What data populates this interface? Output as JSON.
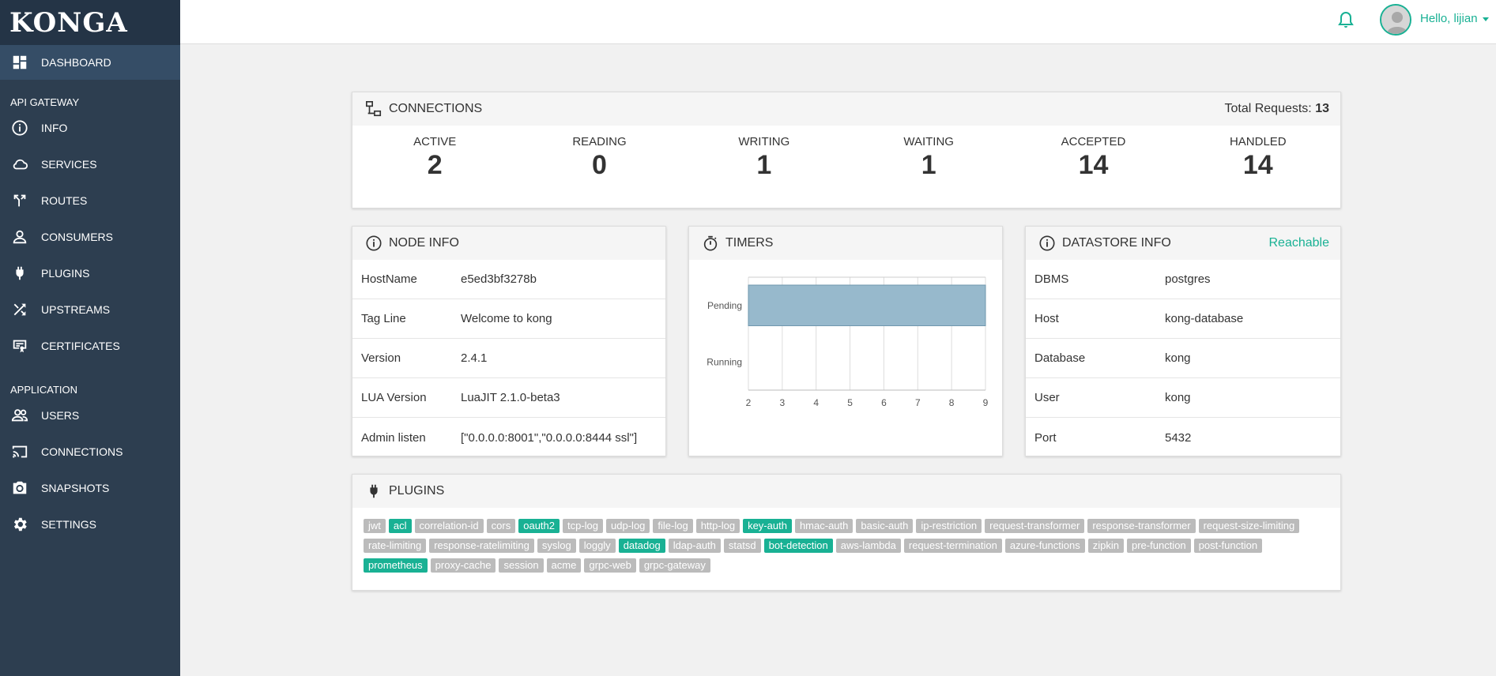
{
  "brand": "KONGA",
  "nav": {
    "dashboard": "DASHBOARD",
    "section_api": "API GATEWAY",
    "api_items": [
      "INFO",
      "SERVICES",
      "ROUTES",
      "CONSUMERS",
      "PLUGINS",
      "UPSTREAMS",
      "CERTIFICATES"
    ],
    "section_app": "APPLICATION",
    "app_items": [
      "USERS",
      "CONNECTIONS",
      "SNAPSHOTS",
      "SETTINGS"
    ]
  },
  "topbar": {
    "greeting": "Hello, lijian"
  },
  "connections": {
    "title": "CONNECTIONS",
    "total_label": "Total Requests:",
    "total_value": "13",
    "stats": [
      {
        "label": "ACTIVE",
        "value": "2"
      },
      {
        "label": "READING",
        "value": "0"
      },
      {
        "label": "WRITING",
        "value": "1"
      },
      {
        "label": "WAITING",
        "value": "1"
      },
      {
        "label": "ACCEPTED",
        "value": "14"
      },
      {
        "label": "HANDLED",
        "value": "14"
      }
    ]
  },
  "node_info": {
    "title": "NODE INFO",
    "rows": [
      {
        "k": "HostName",
        "v": "e5ed3bf3278b"
      },
      {
        "k": "Tag Line",
        "v": "Welcome to kong"
      },
      {
        "k": "Version",
        "v": "2.4.1"
      },
      {
        "k": "LUA Version",
        "v": "LuaJIT 2.1.0-beta3"
      },
      {
        "k": "Admin listen",
        "v": "[\"0.0.0.0:8001\",\"0.0.0.0:8444 ssl\"]"
      }
    ]
  },
  "timers": {
    "title": "TIMERS",
    "chart_data": {
      "type": "bar",
      "orientation": "horizontal",
      "categories": [
        "Pending",
        "Running"
      ],
      "values": [
        9,
        0
      ],
      "xlim": [
        2,
        9
      ],
      "xticks": [
        "2",
        "3",
        "4",
        "5",
        "6",
        "7",
        "8",
        "9"
      ],
      "color": "#97b9cc"
    }
  },
  "datastore": {
    "title": "DATASTORE INFO",
    "status": "Reachable",
    "rows": [
      {
        "k": "DBMS",
        "v": "postgres"
      },
      {
        "k": "Host",
        "v": "kong-database"
      },
      {
        "k": "Database",
        "v": "kong"
      },
      {
        "k": "User",
        "v": "kong"
      },
      {
        "k": "Port",
        "v": "5432"
      }
    ]
  },
  "plugins": {
    "title": "PLUGINS",
    "items": [
      {
        "name": "jwt",
        "on": false
      },
      {
        "name": "acl",
        "on": true
      },
      {
        "name": "correlation-id",
        "on": false
      },
      {
        "name": "cors",
        "on": false
      },
      {
        "name": "oauth2",
        "on": true
      },
      {
        "name": "tcp-log",
        "on": false
      },
      {
        "name": "udp-log",
        "on": false
      },
      {
        "name": "file-log",
        "on": false
      },
      {
        "name": "http-log",
        "on": false
      },
      {
        "name": "key-auth",
        "on": true
      },
      {
        "name": "hmac-auth",
        "on": false
      },
      {
        "name": "basic-auth",
        "on": false
      },
      {
        "name": "ip-restriction",
        "on": false
      },
      {
        "name": "request-transformer",
        "on": false
      },
      {
        "name": "response-transformer",
        "on": false
      },
      {
        "name": "request-size-limiting",
        "on": false
      },
      {
        "name": "rate-limiting",
        "on": false
      },
      {
        "name": "response-ratelimiting",
        "on": false
      },
      {
        "name": "syslog",
        "on": false
      },
      {
        "name": "loggly",
        "on": false
      },
      {
        "name": "datadog",
        "on": true
      },
      {
        "name": "ldap-auth",
        "on": false
      },
      {
        "name": "statsd",
        "on": false
      },
      {
        "name": "bot-detection",
        "on": true
      },
      {
        "name": "aws-lambda",
        "on": false
      },
      {
        "name": "request-termination",
        "on": false
      },
      {
        "name": "azure-functions",
        "on": false
      },
      {
        "name": "zipkin",
        "on": false
      },
      {
        "name": "pre-function",
        "on": false
      },
      {
        "name": "post-function",
        "on": false
      },
      {
        "name": "prometheus",
        "on": true
      },
      {
        "name": "proxy-cache",
        "on": false
      },
      {
        "name": "session",
        "on": false
      },
      {
        "name": "acme",
        "on": false
      },
      {
        "name": "grpc-web",
        "on": false
      },
      {
        "name": "grpc-gateway",
        "on": false
      }
    ]
  }
}
